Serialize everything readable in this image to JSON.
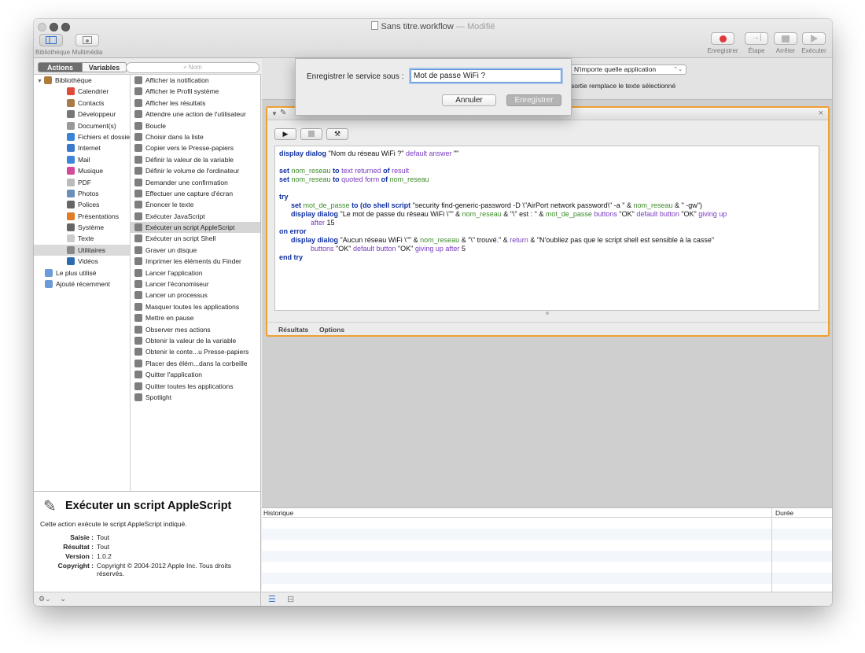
{
  "window": {
    "title": "Sans titre.workflow",
    "modified": "— Modifié"
  },
  "toolbar": {
    "library_label": "Bibliothèque",
    "media_label": "Multimédia",
    "record_label": "Enregistrer",
    "step_label": "Étape",
    "stop_label": "Arrêter",
    "run_label": "Exécuter"
  },
  "library": {
    "tab_actions": "Actions",
    "tab_variables": "Variables",
    "search_placeholder": "Nom",
    "categories": [
      {
        "label": "Bibliothèque",
        "icon": "library-icon"
      },
      {
        "label": "Calendrier",
        "icon": "calendar-icon"
      },
      {
        "label": "Contacts",
        "icon": "contacts-icon"
      },
      {
        "label": "Développeur",
        "icon": "tools-icon"
      },
      {
        "label": "Document(s)",
        "icon": "document-icon"
      },
      {
        "label": "Fichiers et dossiers",
        "icon": "finder-icon"
      },
      {
        "label": "Internet",
        "icon": "globe-icon"
      },
      {
        "label": "Mail",
        "icon": "mail-icon"
      },
      {
        "label": "Musique",
        "icon": "music-icon"
      },
      {
        "label": "PDF",
        "icon": "pdf-icon"
      },
      {
        "label": "Photos",
        "icon": "photos-icon"
      },
      {
        "label": "Polices",
        "icon": "fonts-icon"
      },
      {
        "label": "Présentations",
        "icon": "presentation-icon"
      },
      {
        "label": "Système",
        "icon": "system-icon"
      },
      {
        "label": "Texte",
        "icon": "text-icon"
      },
      {
        "label": "Utilitaires",
        "icon": "utilities-icon"
      },
      {
        "label": "Vidéos",
        "icon": "video-icon"
      },
      {
        "label": "Le plus utilisé",
        "icon": "folder-icon"
      },
      {
        "label": "Ajouté récemment",
        "icon": "folder-icon"
      }
    ],
    "actions": [
      "Afficher la notification",
      "Afficher le Profil système",
      "Afficher les résultats",
      "Attendre une action de l'utilisateur",
      "Boucle",
      "Choisir dans la liste",
      "Copier vers le Presse-papiers",
      "Définir la valeur de la variable",
      "Définir le volume de l'ordinateur",
      "Demander une confirmation",
      "Effectuer une capture d'écran",
      "Énoncer le texte",
      "Exécuter JavaScript",
      "Exécuter un script AppleScript",
      "Exécuter un script Shell",
      "Graver un disque",
      "Imprimer les éléments du Finder",
      "Lancer l'application",
      "Lancer l'économiseur",
      "Lancer un processus",
      "Masquer toutes les applications",
      "Mettre en pause",
      "Observer mes actions",
      "Obtenir la valeur de la variable",
      "Obtenir le conte...u Presse-papiers",
      "Placer des élém...dans la corbeille",
      "Quitter l'application",
      "Quitter toutes les applications",
      "Spotlight"
    ]
  },
  "description": {
    "title": "Exécuter un script AppleScript",
    "text": "Cette action exécute le script AppleScript indiqué.",
    "meta": [
      {
        "key": "Saisie :",
        "value": "Tout"
      },
      {
        "key": "Résultat :",
        "value": "Tout"
      },
      {
        "key": "Version :",
        "value": "1.0.2"
      },
      {
        "key": "Copyright :",
        "value": "Copyright © 2004-2012 Apple Inc. Tous droits réservés."
      }
    ]
  },
  "service": {
    "app_select": "N'importe quelle application",
    "note": "sortie remplace le texte sélectionné"
  },
  "action_card": {
    "tab_results": "Résultats",
    "tab_options": "Options",
    "code": [
      [
        {
          "t": "display dialog",
          "c": "kw"
        },
        {
          "t": " \"Nom du réseau WiFi ?\" ",
          "c": "st"
        },
        {
          "t": "default answer",
          "c": "pr"
        },
        {
          "t": " \"\"",
          "c": "st"
        }
      ],
      [],
      [
        {
          "t": "set ",
          "c": "kw"
        },
        {
          "t": "nom_reseau",
          "c": "vr"
        },
        {
          "t": " to ",
          "c": "kw"
        },
        {
          "t": "text returned",
          "c": "pr"
        },
        {
          "t": " of ",
          "c": "kw"
        },
        {
          "t": "result",
          "c": "pr"
        }
      ],
      [
        {
          "t": "set ",
          "c": "kw"
        },
        {
          "t": "nom_reseau",
          "c": "vr"
        },
        {
          "t": " to ",
          "c": "kw"
        },
        {
          "t": "quoted form",
          "c": "pr"
        },
        {
          "t": " of ",
          "c": "kw"
        },
        {
          "t": "nom_reseau",
          "c": "vr"
        }
      ],
      [],
      [
        {
          "t": "try",
          "c": "kw"
        }
      ],
      [
        {
          "t": "      set ",
          "c": "kw"
        },
        {
          "t": "mot_de_passe",
          "c": "vr"
        },
        {
          "t": " to (",
          "c": "kw"
        },
        {
          "t": "do shell script",
          "c": "kw"
        },
        {
          "t": " \"security find-generic-password -D \\\"AirPort network password\\\" -a \" & ",
          "c": "st"
        },
        {
          "t": "nom_reseau",
          "c": "vr"
        },
        {
          "t": " & \" -gw\")",
          "c": "st"
        }
      ],
      [
        {
          "t": "      display dialog",
          "c": "kw"
        },
        {
          "t": " \"Le mot de passe du réseau WiFi \\\"\" & ",
          "c": "st"
        },
        {
          "t": "nom_reseau",
          "c": "vr"
        },
        {
          "t": " & \"\\\" est : \" & ",
          "c": "st"
        },
        {
          "t": "mot_de_passe",
          "c": "vr"
        },
        {
          "t": " buttons",
          "c": "pr"
        },
        {
          "t": " \"OK\" ",
          "c": "st"
        },
        {
          "t": "default button",
          "c": "pr"
        },
        {
          "t": " \"OK\" ",
          "c": "st"
        },
        {
          "t": "giving up",
          "c": "pr"
        }
      ],
      [
        {
          "t": "                after",
          "c": "pr"
        },
        {
          "t": " 15",
          "c": "st"
        }
      ],
      [
        {
          "t": "on error",
          "c": "kw"
        }
      ],
      [
        {
          "t": "      display dialog",
          "c": "kw"
        },
        {
          "t": " \"Aucun réseau WiFi \\\"\" & ",
          "c": "st"
        },
        {
          "t": "nom_reseau",
          "c": "vr"
        },
        {
          "t": " & \"\\\" trouvé.\" & ",
          "c": "st"
        },
        {
          "t": "return",
          "c": "pr"
        },
        {
          "t": " & \"N'oubliez pas que le script shell est sensible à la casse\"",
          "c": "st"
        }
      ],
      [
        {
          "t": "                buttons",
          "c": "pr"
        },
        {
          "t": " \"OK\" ",
          "c": "st"
        },
        {
          "t": "default button",
          "c": "pr"
        },
        {
          "t": " \"OK\" ",
          "c": "st"
        },
        {
          "t": "giving up after",
          "c": "pr"
        },
        {
          "t": " 5",
          "c": "st"
        }
      ],
      [
        {
          "t": "end try",
          "c": "kw"
        }
      ]
    ]
  },
  "history": {
    "col_history": "Historique",
    "col_duration": "Durée"
  },
  "sheet": {
    "label": "Enregistrer le service sous :",
    "value": "Mot de passe WiFi ?",
    "cancel": "Annuler",
    "save": "Enregistrer"
  },
  "colors": {
    "accent": "#f0a030",
    "keyword": "#0f2fa0",
    "variable": "#3d8a2a",
    "property": "#7a3bc0",
    "record": "#e0393b"
  }
}
